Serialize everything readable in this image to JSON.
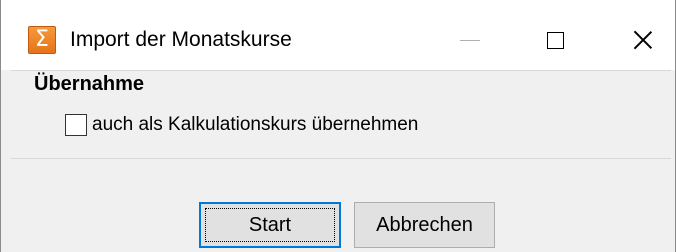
{
  "window": {
    "title": "Import der Monatskurse",
    "icon": "sigma-icon",
    "icon_glyph": "Σ",
    "accent_color": "#0078d7",
    "icon_color": "#f08a2a"
  },
  "group": {
    "title": "Übernahme"
  },
  "checkbox": {
    "label": "auch als Kalkulationskurs übernehmen",
    "checked": false
  },
  "buttons": {
    "start_label": "Start",
    "cancel_label": "Abbrechen"
  }
}
